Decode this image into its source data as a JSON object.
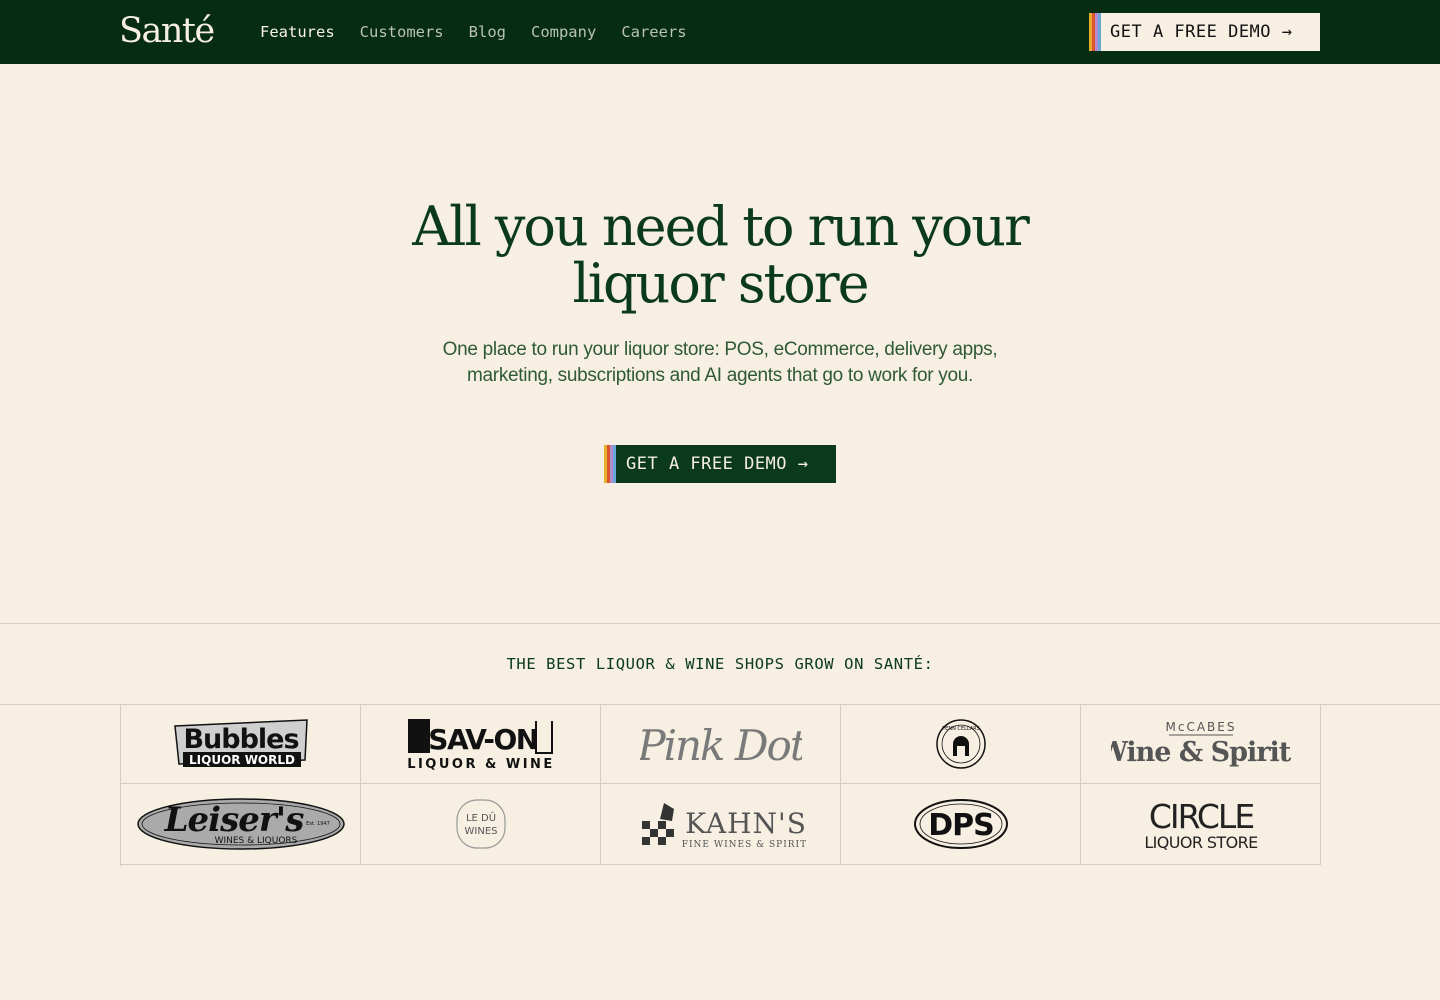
{
  "nav": {
    "logo": "Santé",
    "links": [
      {
        "label": "Features",
        "active": true
      },
      {
        "label": "Customers",
        "active": false
      },
      {
        "label": "Blog",
        "active": false
      },
      {
        "label": "Company",
        "active": false
      },
      {
        "label": "Careers",
        "active": false
      }
    ],
    "cta_label": "GET A FREE DEMO →"
  },
  "hero": {
    "title_line1": "All you need to run your",
    "title_line2": "liquor store",
    "subtitle_line1": "One place to run your liquor store: POS, eCommerce, delivery apps,",
    "subtitle_line2": "marketing, subscriptions and AI agents that go to work for you.",
    "cta_label": "GET A FREE DEMO →"
  },
  "customers": {
    "heading": "THE BEST LIQUOR & WINE SHOPS GROW ON SANTÉ:",
    "logos": [
      {
        "name": "Bubbles",
        "sub": "LIQUOR WORLD"
      },
      {
        "name": "SAV-ON",
        "sub": "LIQUOR & WINE"
      },
      {
        "name": "Pink Dot",
        "sub": ""
      },
      {
        "name": "PENN CELLARS",
        "sub": ""
      },
      {
        "name": "Wine & Spirits",
        "top": "McCABES"
      },
      {
        "name": "Leiser's",
        "sub": "WINES & LIQUORS",
        "est": "Est. 1947"
      },
      {
        "name": "LE DÛ",
        "sub": "WINES"
      },
      {
        "name": "KAHN'S",
        "sub": "FINE WINES & SPIRITS"
      },
      {
        "name": "DPS",
        "sub": ""
      },
      {
        "name": "CIRCLE",
        "sub": "LIQUOR STORE"
      }
    ]
  },
  "colors": {
    "nav_bg": "#062c14",
    "page_bg": "#f6efe2",
    "brand_green": "#0b3a1b",
    "stripe": [
      "#e8ac2c",
      "#d9552f",
      "#b28ccd",
      "#6aa5d8"
    ]
  }
}
